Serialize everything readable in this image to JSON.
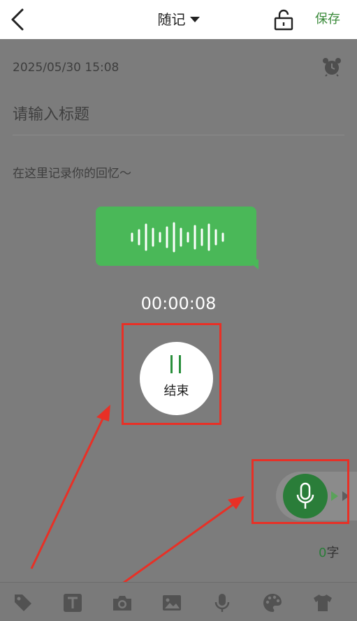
{
  "header": {
    "title": "随记",
    "save_label": "保存"
  },
  "note": {
    "date": "2025/05/30 15:08",
    "title_placeholder": "请输入标题",
    "content_placeholder": "在这里记录你的回忆～"
  },
  "recording": {
    "elapsed": "00:00:08",
    "stop_label": "结束"
  },
  "word_count": {
    "count": "0",
    "unit": "字"
  },
  "toolbar": {
    "items": [
      "tag-icon",
      "text-format-icon",
      "camera-icon",
      "image-icon",
      "microphone-icon",
      "palette-icon",
      "shirt-icon"
    ]
  },
  "colors": {
    "accent": "#3a8a3a",
    "bubble": "#4ab858",
    "mic_fab": "#2a7d39",
    "highlight": "#e83026",
    "overlay": "#7c7c7c"
  }
}
